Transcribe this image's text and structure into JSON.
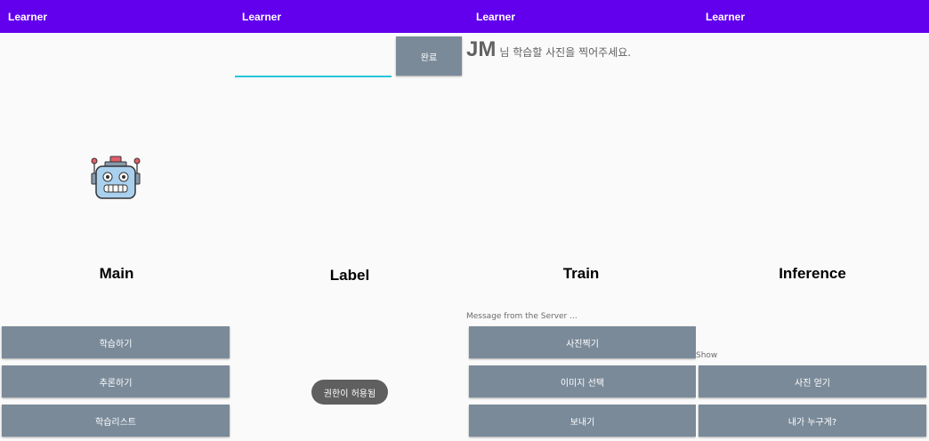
{
  "app": {
    "title": "Learner",
    "accent_color": "#6200ee",
    "button_color": "#7a8a99"
  },
  "main": {
    "icon": "robot-icon",
    "heading": "Main",
    "buttons": [
      "학습하기",
      "추론하기",
      "학습리스트"
    ]
  },
  "label": {
    "input_value": "",
    "done_label": "완료",
    "user_name": "JM",
    "prompt_message": "님 학습할 사진을 찍어주세요.",
    "heading": "Label",
    "toast": "권한이 허용됨"
  },
  "train": {
    "heading": "Train",
    "server_message": "Message from the Server ...",
    "buttons": [
      "사진찍기",
      "이미지 선택",
      "보내기"
    ]
  },
  "inference": {
    "heading": "Inference",
    "show_label": "Show",
    "buttons": [
      "사진 얻기",
      "내가 누구게?"
    ]
  }
}
